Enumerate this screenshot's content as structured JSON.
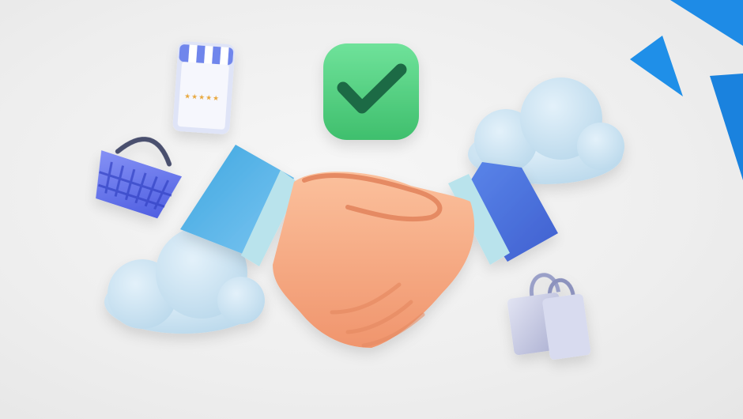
{
  "scene": {
    "background": "#efefef",
    "colors": {
      "sleeve_left": "#5bb0e8",
      "sleeve_right": "#4a6fd6",
      "cuff": "#b9e3ec",
      "skin": "#f6a57f",
      "skin_shadow": "#e58a63",
      "check_bg": "#4ccf7c",
      "check_mark": "#1f6a45",
      "cloud": "#c7e0ef",
      "basket": "#6a78ee",
      "bag": "#c9cde6",
      "store_awning": "#6f86ec",
      "corner_accent": "#1e88e5"
    },
    "objects": [
      {
        "name": "handshake",
        "icon": "handshake-icon"
      },
      {
        "name": "checkmark-badge",
        "icon": "check-icon"
      },
      {
        "name": "shopping-basket",
        "icon": "basket-icon"
      },
      {
        "name": "mobile-store",
        "icon": "store-phone-icon",
        "rating_stars": 5
      },
      {
        "name": "shopping-bag",
        "icon": "bag-icon"
      },
      {
        "name": "cloud-left",
        "icon": "cloud-icon"
      },
      {
        "name": "cloud-right",
        "icon": "cloud-icon"
      }
    ]
  }
}
